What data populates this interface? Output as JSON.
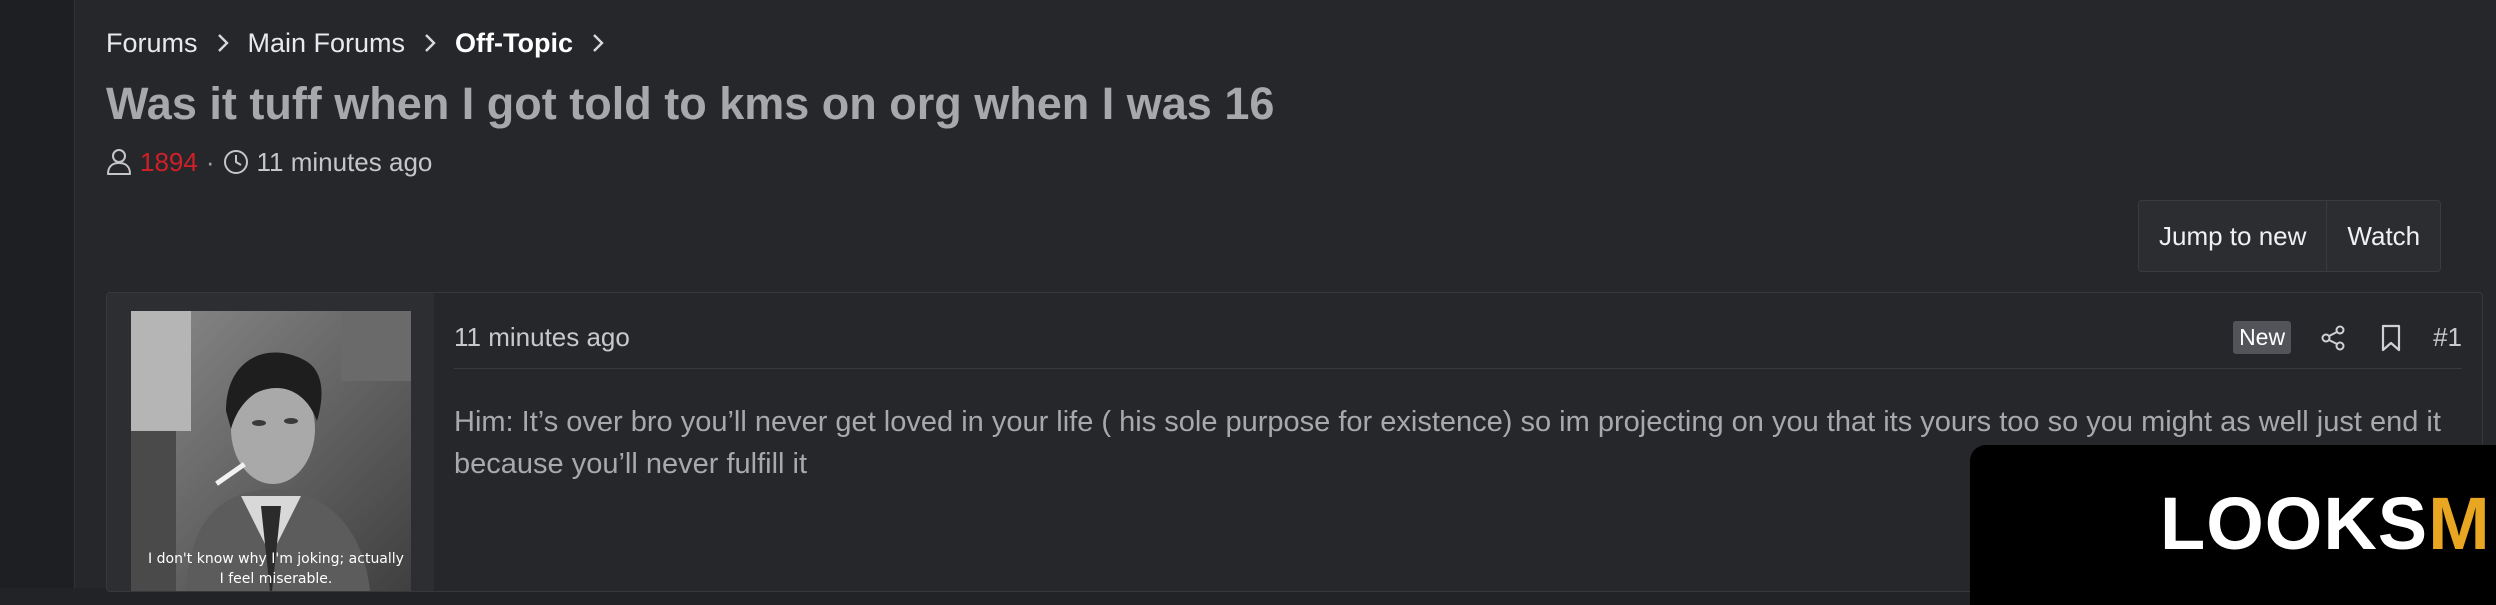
{
  "breadcrumb": {
    "items": [
      "Forums",
      "Main Forums",
      "Off-Topic"
    ]
  },
  "thread": {
    "title": "Was it tuff when I got told to kms on org when I was 16",
    "author": "1894",
    "separator": "·",
    "posted": "11 minutes ago"
  },
  "toolbar": {
    "jump_label": "Jump to new",
    "watch_label": "Watch"
  },
  "post": {
    "time": "11 minutes ago",
    "badge": "New",
    "number": "#1",
    "avatar_caption_line1": "I don't know why I'm joking; actually",
    "avatar_caption_line2": "I feel miserable.",
    "body": "Him: It’s over bro you’ll never get loved in your life ( his sole purpose for existence) so im projecting on you that its yours too so you might as well just end it because you’ll never fulfill it"
  },
  "ad": {
    "logo_main": "LOOKS",
    "logo_accent": "M"
  },
  "colors": {
    "author": "#d11f28",
    "background": "#26272b",
    "accent": "#e8a623"
  }
}
